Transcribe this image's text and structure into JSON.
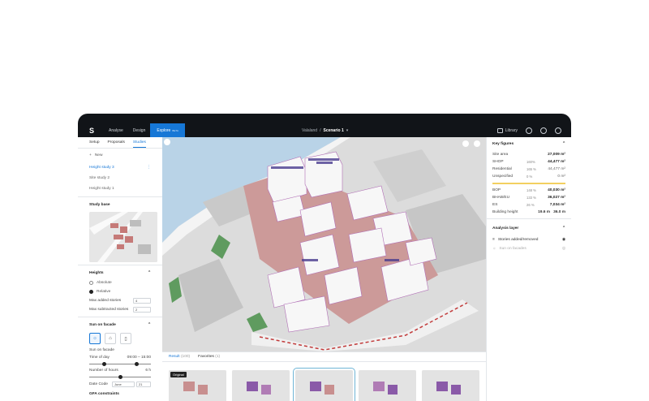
{
  "topbar": {
    "nav": [
      "Analyse",
      "Design"
    ],
    "active_tab": "Explore",
    "active_badge": "BETA",
    "breadcrumb_project": "Valaland",
    "breadcrumb_sep": "/",
    "breadcrumb_scenario": "Scenario 1",
    "library_label": "Library"
  },
  "left": {
    "tabs": [
      "Setup",
      "Proposals",
      "Studies"
    ],
    "new_label": "New",
    "studies": [
      "Height study 3",
      "Site study 2",
      "Height study 1"
    ],
    "study_base": "Study base",
    "heights": "Heights",
    "absolute": "Absolute",
    "relative": "Relative",
    "max_added": "Max added stories",
    "max_added_val": "4",
    "max_sub": "Max subtracted stories",
    "max_sub_val": "2",
    "sun_facade": "Sun on facade",
    "sun_facade2": "Sun on facade",
    "time_of_day": "Time of day",
    "time_val": "09:00 – 15:00",
    "num_hours": "Number of hours",
    "num_hours_val": "6 h",
    "date_label": "Date Code",
    "month": "June",
    "day": "21",
    "gfa": "GFA constraints"
  },
  "results": {
    "tab1": "Result",
    "tab1_count": "(100)",
    "tab2": "Favorites",
    "tab2_count": "(1)",
    "original": "Original"
  },
  "right": {
    "key_figures": "Key figures",
    "site_area_label": "Site area",
    "site_area_val": "27,009 m²",
    "rows": [
      {
        "label": "SHOP",
        "pct": "160%",
        "val": "44,477 m²",
        "light": false
      },
      {
        "label": "Residential",
        "pct": "165 %",
        "val": "44,477 m²",
        "light": true
      },
      {
        "label": "Unspecified",
        "pct": "0 %",
        "val": "0 m²",
        "light": true
      }
    ],
    "rows2": [
      {
        "label": "BOP",
        "pct": "148 %",
        "val": "40,030 m²"
      },
      {
        "label": "BHAB/EU",
        "pct": "133 %",
        "val": "36,027 m²"
      },
      {
        "label": "ES",
        "pct": "26 %",
        "val": "7,034 m²"
      }
    ],
    "building_height_label": "Building height",
    "bh_min": "19.6 m",
    "bh_max": "36.0 m",
    "analysis_layer": "Analysis layer",
    "layer1": "Stories added/removed",
    "layer2": "Sun on facades"
  }
}
